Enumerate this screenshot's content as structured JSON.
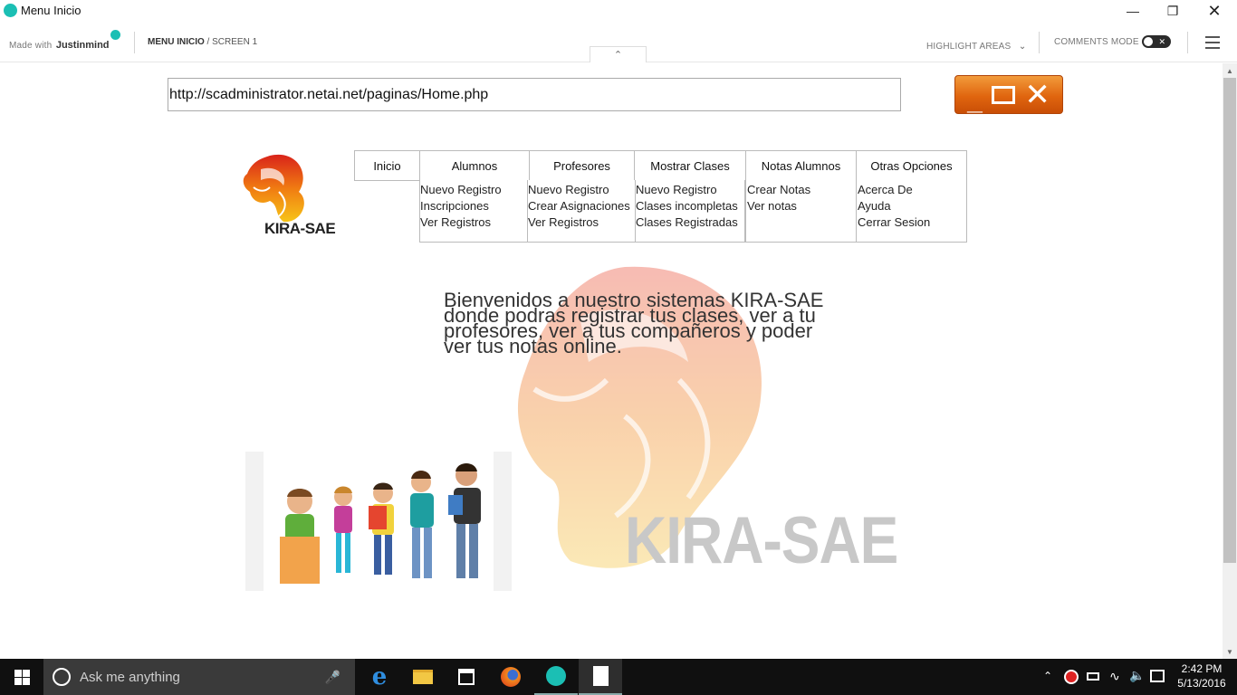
{
  "window": {
    "title": "Menu Inicio"
  },
  "toolbar": {
    "made_with": "Made with",
    "brand": "Justinmind",
    "screen_page": "MENU INICIO",
    "screen_sep": " / ",
    "screen_name": "SCREEN 1",
    "highlight_areas": "HIGHLIGHT AREAS",
    "comments_mode": "COMMENTS MODE",
    "comments_mode_on": false
  },
  "canvas": {
    "url": "http://scadministrator.netai.net/paginas/Home.php",
    "logo_text": "KIRA-SAE",
    "menu": [
      {
        "label": "Inicio",
        "items": []
      },
      {
        "label": "Alumnos",
        "items": [
          "Nuevo Registro",
          "Inscripciones",
          "Ver Registros"
        ]
      },
      {
        "label": "Profesores",
        "items": [
          "Nuevo Registro",
          "Crear Asignaciones",
          "Ver Registros"
        ]
      },
      {
        "label": "Mostrar Clases",
        "items": [
          "Nuevo Registro",
          "Clases incompletas",
          "Clases Registradas"
        ]
      },
      {
        "label": "Notas Alumnos",
        "items": [
          "Crear Notas",
          "Ver notas"
        ]
      },
      {
        "label": "Otras Opciones",
        "items": [
          "Acerca De",
          "Ayuda",
          "Cerrar Sesion"
        ]
      }
    ],
    "welcome_lines": [
      "Bienvenidos a nuestro sistemas KIRA-SAE",
      "donde podras registrar tus clases, ver a tu",
      "profesores, ver a tus compañeros y poder",
      "ver tus notas online."
    ],
    "watermark_text": "KIRA-SAE"
  },
  "taskbar": {
    "search_placeholder": "Ask me anything",
    "time": "2:42 PM",
    "date": "5/13/2016"
  },
  "colors": {
    "accent": "#1bbfb4",
    "orange": "#e0650f",
    "taskbar": "#101010"
  },
  "icons": [
    "app-logo-icon",
    "minimize-icon",
    "restore-icon",
    "close-icon",
    "chevron-down-icon",
    "chevron-up-icon",
    "hamburger-menu-icon",
    "windows-start-icon",
    "cortana-icon",
    "microphone-icon",
    "edge-icon",
    "file-explorer-icon",
    "store-icon",
    "firefox-icon",
    "justinmind-icon",
    "document-icon",
    "tray-up-icon",
    "antivirus-icon",
    "battery-icon",
    "wifi-icon",
    "volume-icon",
    "notifications-icon"
  ]
}
